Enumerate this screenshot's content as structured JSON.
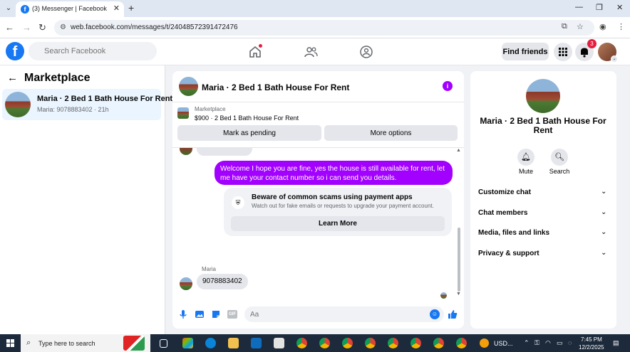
{
  "browser": {
    "tab_title": "(3) Messenger | Facebook",
    "url": "web.facebook.com/messages/t/24048572391472476"
  },
  "header": {
    "search_placeholder": "Search Facebook",
    "find_friends_label": "Find friends",
    "notification_count": "3"
  },
  "left_panel": {
    "title": "Marketplace",
    "conversations": [
      {
        "name": "Maria · 2 Bed 1 Bath House For Rent",
        "snippet": "Maria: 9078883402 · 21h"
      }
    ]
  },
  "chat": {
    "title": "Maria · 2 Bed 1 Bath House For Rent",
    "marketplace_label": "Marketplace",
    "listing": "$900 · 2 Bed 1 Bath House For Rent",
    "mark_pending_label": "Mark as pending",
    "more_options_label": "More options",
    "outgoing_message": "Welcome I hope you are fine, yes the house is still available for rent, let me have your contact number so i can send you  details.",
    "scam_warning": {
      "title": "Beware of common scams using payment apps",
      "description": "Watch out for fake emails or requests to upgrade your payment account.",
      "button_label": "Learn More"
    },
    "sender_name": "Maria",
    "incoming_message": "9078883402",
    "composer_placeholder": "Aa"
  },
  "right_panel": {
    "name": "Maria · 2 Bed 1 Bath House For Rent",
    "mute_label": "Mute",
    "search_label": "Search",
    "sections": [
      "Customize chat",
      "Chat members",
      "Media, files and links",
      "Privacy & support"
    ]
  },
  "taskbar": {
    "search_text": "Type here to search",
    "currency_text": "USD...",
    "time": "7:45 PM",
    "date": "12/2/2025"
  }
}
